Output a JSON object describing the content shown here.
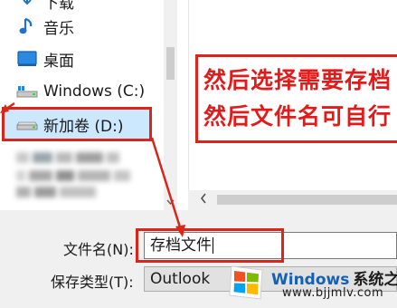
{
  "nav": {
    "items": [
      {
        "label": "音乐",
        "icon": "music-note-icon"
      },
      {
        "label": "桌面",
        "icon": "desktop-icon"
      },
      {
        "label": "Windows (C:)",
        "icon": "drive-c-icon"
      },
      {
        "label": "新加卷 (D:)",
        "icon": "drive-d-icon"
      }
    ],
    "partial_top_label": "下载"
  },
  "annotation": {
    "line1": "然后选择需要存档",
    "line2": "然后文件名可自行"
  },
  "form": {
    "filename_label": "文件名(N):",
    "filename_value": "存档文件",
    "filetype_label": "保存类型(T):",
    "filetype_value": "Outlook"
  },
  "watermark": {
    "title": "Windows",
    "title_cn": "系统之家",
    "url": "www.bjjmlv.com"
  },
  "colors": {
    "annotation_red": "#e31a1a",
    "selection_bg": "#cce8ff",
    "watermark_blue": "#1560b0"
  }
}
